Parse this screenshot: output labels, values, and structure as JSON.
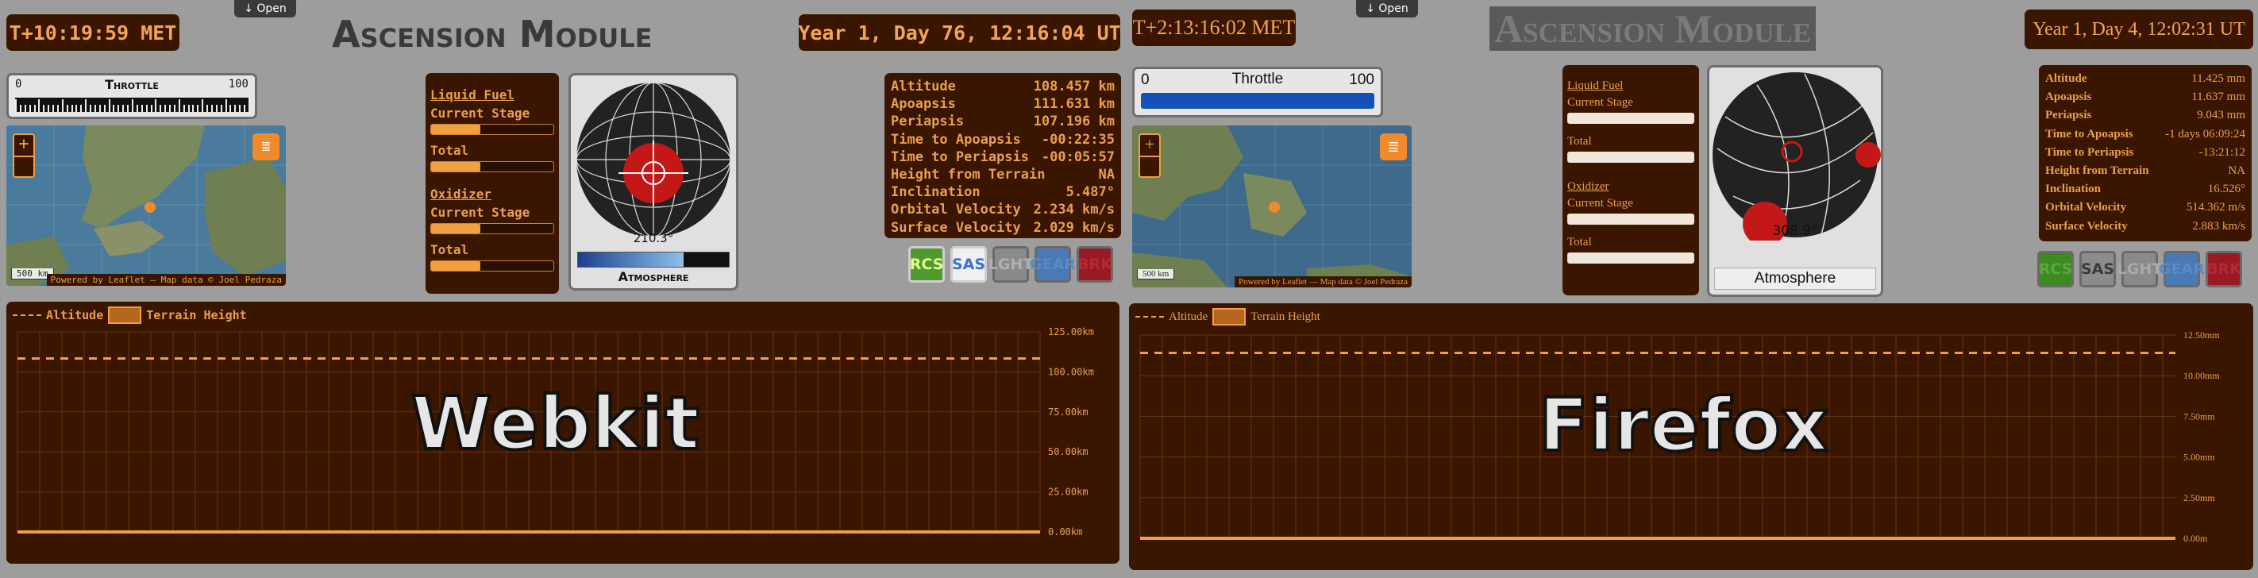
{
  "webkit": {
    "met": "T+10:19:59 MET",
    "open_label": "↓ Open",
    "title": "Ascension Module",
    "ut": "Year 1, Day 76, 12:16:04 UT",
    "throttle": {
      "label": "Throttle",
      "min": "0",
      "max": "100",
      "value_pct": 0
    },
    "map": {
      "zoom_in": "+",
      "scale": "500 km",
      "attribution": "Powered by Leaflet — Map data © Joel Pedraza"
    },
    "resources": {
      "fuel_heading": "Liquid Fuel",
      "oxidizer_heading": "Oxidizer",
      "current_stage": "Current Stage",
      "total": "Total",
      "fuel_stage_pct": 40,
      "fuel_total_pct": 40,
      "ox_stage_pct": 40,
      "ox_total_pct": 40
    },
    "navball": {
      "heading": "210.3°",
      "atmosphere": "Atmosphere",
      "atm_pct": 70
    },
    "orbit": [
      {
        "label": "Altitude",
        "value": "108.457 km"
      },
      {
        "label": "Apoapsis",
        "value": "111.631 km"
      },
      {
        "label": "Periapsis",
        "value": "107.196 km"
      },
      {
        "label": "Time to Apoapsis",
        "value": "-00:22:35"
      },
      {
        "label": "Time to Periapsis",
        "value": "-00:05:57"
      },
      {
        "label": "Height from Terrain",
        "value": "NA"
      },
      {
        "label": "Inclination",
        "value": "5.487°"
      },
      {
        "label": "Orbital Velocity",
        "value": "2.234 km/s"
      },
      {
        "label": "Surface Velocity",
        "value": "2.029 km/s"
      }
    ],
    "buttons": [
      {
        "label": "RCS",
        "bg": "#4f9a2c",
        "fg": "#e0ff90",
        "border": "#cfcfcf"
      },
      {
        "label": "SAS",
        "bg": "#f0f0f0",
        "fg": "#3b6fd8",
        "border": "#cfcfcf"
      },
      {
        "label": "LGHT",
        "bg": "#8a8a8a",
        "fg": "#b0b0b0",
        "border": "#6a6a6a"
      },
      {
        "label": "GEAR",
        "bg": "#4a7ab5",
        "fg": "#5a8ac5",
        "border": "#6a6a6a"
      },
      {
        "label": "BRK",
        "bg": "#9a1a24",
        "fg": "#b32a34",
        "border": "#6a6a6a"
      }
    ],
    "legend": {
      "altitude": "Altitude",
      "terrain": "Terrain Height"
    },
    "watermark": "Webkit",
    "chart_data": {
      "type": "line",
      "title": "",
      "xlabel": "",
      "ylabel": "",
      "y_ticks": [
        "0.00km",
        "25.00km",
        "50.00km",
        "75.00km",
        "100.00km",
        "125.00km"
      ],
      "ylim": [
        0,
        125
      ],
      "series": [
        {
          "name": "Altitude",
          "style": "dashed",
          "values": [
            108.4,
            108.4,
            108.4,
            108.4,
            108.4,
            108.4,
            108.4,
            108.4,
            108.4,
            108.4,
            108.4,
            108.4,
            108.4,
            108.4,
            108.4,
            108.4,
            108.4,
            108.4,
            108.4,
            108.4,
            108.4,
            108.4,
            108.4,
            108.4,
            108.4,
            108.4,
            108.4,
            108.4,
            108.4,
            108.4
          ]
        },
        {
          "name": "Terrain Height",
          "style": "solid",
          "values": [
            0,
            0,
            0,
            0,
            0,
            0,
            0,
            0,
            0,
            0,
            0,
            0,
            0,
            0,
            0,
            0,
            0,
            0,
            0,
            0,
            0,
            0,
            0,
            0,
            0,
            0,
            0,
            0,
            0,
            0
          ]
        }
      ]
    }
  },
  "firefox": {
    "met": "T+2:13:16:02 MET",
    "open_label": "↓ Open",
    "title": "Ascension Module",
    "ut": "Year 1, Day 4, 12:02:31 UT",
    "throttle": {
      "label": "Throttle",
      "min": "0",
      "max": "100",
      "value_pct": 100
    },
    "map": {
      "zoom_in": "+",
      "scale": "500 km",
      "attribution": "Powered by Leaflet — Map data © Joel Pedraza"
    },
    "resources": {
      "fuel_heading": "Liquid Fuel",
      "oxidizer_heading": "Oxidizer",
      "current_stage": "Current Stage",
      "total": "Total",
      "fuel_stage_pct": 0,
      "fuel_total_pct": 0,
      "ox_stage_pct": 0,
      "ox_total_pct": 0
    },
    "navball": {
      "heading": "308.9°",
      "atmosphere": "Atmosphere"
    },
    "orbit": [
      {
        "label": "Altitude",
        "value": "11.425 mm"
      },
      {
        "label": "Apoapsis",
        "value": "11.637 mm"
      },
      {
        "label": "Periapsis",
        "value": "9.043 mm"
      },
      {
        "label": "Time to Apoapsis",
        "value": "-1 days 06:09:24"
      },
      {
        "label": "Time to Periapsis",
        "value": "-13:21:12"
      },
      {
        "label": "Height from Terrain",
        "value": "NA"
      },
      {
        "label": "Inclination",
        "value": "16.526°"
      },
      {
        "label": "Orbital Velocity",
        "value": "514.362 m/s"
      },
      {
        "label": "Surface Velocity",
        "value": "2.883 km/s"
      }
    ],
    "buttons": [
      {
        "label": "RCS",
        "bg": "#3e8a22",
        "fg": "#5aa83a",
        "border": "#6a6a6a"
      },
      {
        "label": "SAS",
        "bg": "#8c8c8c",
        "fg": "#3a3a3a",
        "border": "#6a6a6a"
      },
      {
        "label": "LGHT",
        "bg": "#8a8a8a",
        "fg": "#aaaaaa",
        "border": "#6a6a6a"
      },
      {
        "label": "GEAR",
        "bg": "#4a7ab5",
        "fg": "#5a8ac5",
        "border": "#6a6a6a"
      },
      {
        "label": "BRK",
        "bg": "#9a1a24",
        "fg": "#b32a34",
        "border": "#6a6a6a"
      }
    ],
    "legend": {
      "altitude": "Altitude",
      "terrain": "Terrain Height"
    },
    "watermark": "Firefox",
    "chart_data": {
      "type": "line",
      "title": "",
      "xlabel": "",
      "ylabel": "",
      "y_ticks": [
        "0.00m",
        "2.50mm",
        "5.00mm",
        "7.50mm",
        "10.00mm",
        "12.50mm"
      ],
      "ylim": [
        0,
        12.5
      ],
      "series": [
        {
          "name": "Altitude",
          "style": "dashed",
          "values": [
            11.4,
            11.4,
            11.4,
            11.4,
            11.4,
            11.4,
            11.4,
            11.4,
            11.4,
            11.4,
            11.4,
            11.4,
            11.4,
            11.4,
            11.4,
            11.4,
            11.4,
            11.4,
            11.4,
            11.4,
            11.4,
            11.4,
            11.4,
            11.4,
            11.4,
            11.4,
            11.4,
            11.4,
            11.4,
            11.4
          ]
        },
        {
          "name": "Terrain Height",
          "style": "solid",
          "values": [
            0,
            0,
            0,
            0,
            0,
            0,
            0,
            0,
            0,
            0,
            0,
            0,
            0,
            0,
            0,
            0,
            0,
            0,
            0,
            0,
            0,
            0,
            0,
            0,
            0,
            0,
            0,
            0,
            0,
            0
          ]
        }
      ]
    }
  }
}
